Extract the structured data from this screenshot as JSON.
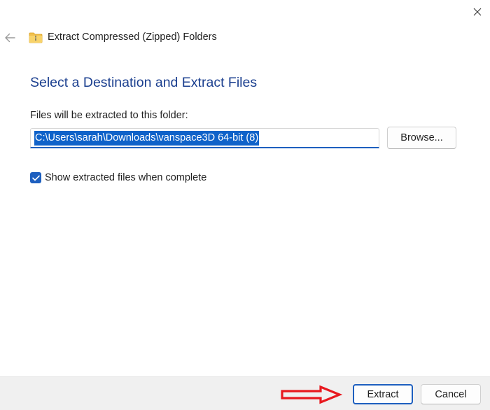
{
  "window": {
    "title": "Extract Compressed (Zipped) Folders"
  },
  "main": {
    "heading": "Select a Destination and Extract Files",
    "destination_label": "Files will be extracted to this folder:",
    "destination_value": "C:\\Users\\sarah\\Downloads\\vanspace3D 64-bit (8)",
    "browse_label": "Browse...",
    "show_files_label": "Show extracted files when complete",
    "show_files_checked": true
  },
  "footer": {
    "extract_label": "Extract",
    "cancel_label": "Cancel"
  },
  "icons": {
    "close": "close-icon",
    "back": "back-arrow-icon",
    "folder": "zipped-folder-icon",
    "check": "checkmark-icon",
    "annotation": "red-arrow-annotation"
  },
  "colors": {
    "accent": "#1d5fbf",
    "heading": "#1b3f8f",
    "selection": "#0f62c9",
    "footer_bg": "#f0f0f0",
    "annotation": "#e8191f"
  }
}
